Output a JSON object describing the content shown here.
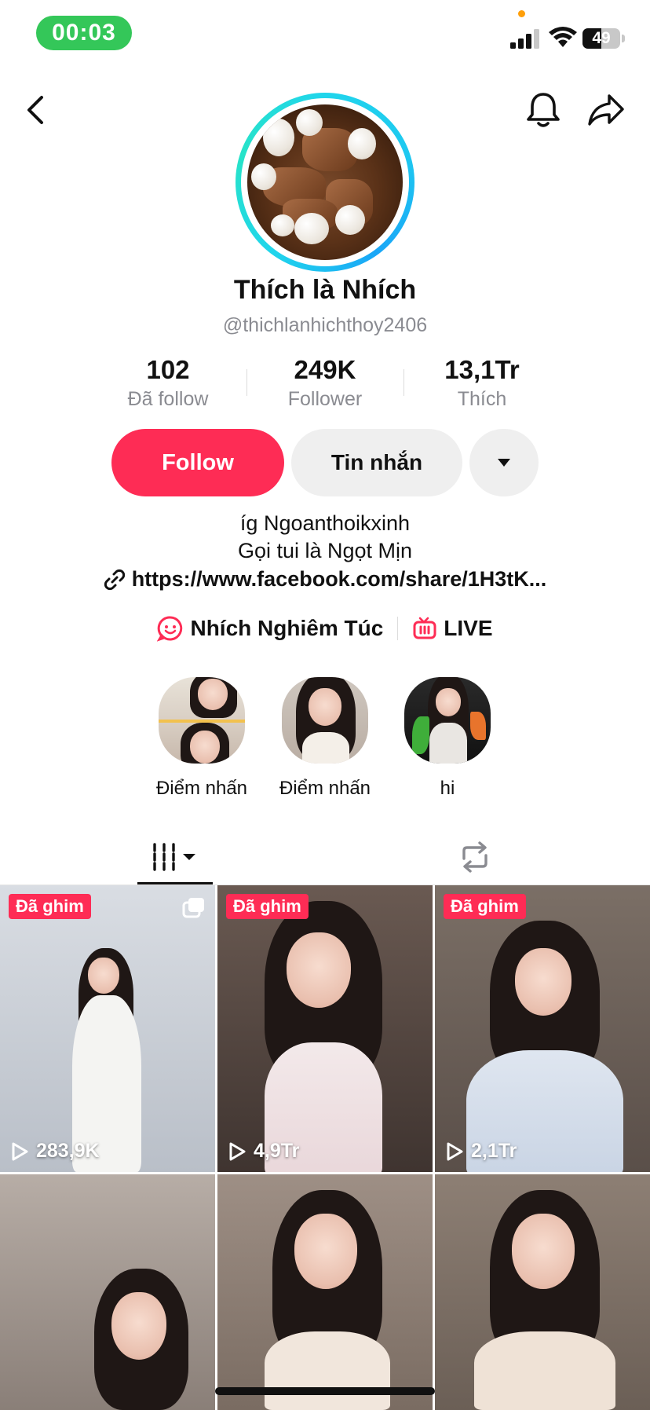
{
  "status_bar": {
    "time": "00:03",
    "battery": "49",
    "battery_level": 0.49
  },
  "profile": {
    "display_name": "Thích là Nhích",
    "username": "@thichlanhichthoy2406",
    "stats": [
      {
        "value": "102",
        "label": "Đã follow"
      },
      {
        "value": "249K",
        "label": "Follower"
      },
      {
        "value": "13,1Tr",
        "label": "Thích"
      }
    ]
  },
  "actions": {
    "follow_label": "Follow",
    "message_label": "Tin nhắn"
  },
  "bio": {
    "line1": "íg  Ngoanthoikxinh",
    "line2": "Gọi tui là Ngọt Mịn",
    "link": "https://www.facebook.com/share/1H3tK..."
  },
  "chips": [
    {
      "label": "Nhích Nghiêm Túc",
      "icon": "face-smile-icon"
    },
    {
      "label": "LIVE",
      "icon": "tv-icon"
    }
  ],
  "highlights": [
    {
      "label": "Điểm nhấn"
    },
    {
      "label": "Điểm nhấn"
    },
    {
      "label": "hi"
    }
  ],
  "tabs": [
    {
      "name": "videos",
      "icon": "grid-bars-icon",
      "active": true
    },
    {
      "name": "reposts",
      "icon": "repost-icon",
      "active": false
    }
  ],
  "videos": [
    {
      "pinned_label": "Đã ghim",
      "views": "283,9K",
      "multi_photo": true
    },
    {
      "pinned_label": "Đã ghim",
      "views": "4,9Tr",
      "multi_photo": false
    },
    {
      "pinned_label": "Đã ghim",
      "views": "2,1Tr",
      "multi_photo": false
    },
    {
      "pinned_label": "",
      "views": "",
      "multi_photo": false
    },
    {
      "pinned_label": "",
      "views": "",
      "multi_photo": false
    },
    {
      "pinned_label": "",
      "views": "",
      "multi_photo": false
    }
  ],
  "colors": {
    "accent": "#fe2c55",
    "ring": "#20d5ec",
    "status_green": "#34c759"
  }
}
